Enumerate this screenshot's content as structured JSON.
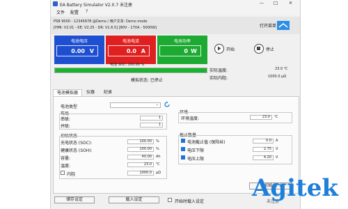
{
  "window": {
    "title": "EA Battery Simulator   V2.0.7   未注册",
    "minimize_glyph": "—",
    "maximize_glyph": "☐",
    "close_glyph": "✕"
  },
  "menu": [
    "文件",
    "配置",
    "?"
  ],
  "device": {
    "line1": "PSB 9000 - 12345678 @Demo / 用户文本: Demo mode",
    "line2": "[HMI: V2.01 - KE: V2.25 - DR: V1.6.5] [80V - 170A - 5000W]",
    "open_menu_label": "打开菜单"
  },
  "tiles": [
    {
      "label": "电池电压",
      "value": "0.00",
      "unit": "V",
      "color": "#1f4fd1"
    },
    {
      "label": "电池电流",
      "value": "0.0",
      "unit": "A",
      "color": "#e02020"
    },
    {
      "label": "电池功率",
      "value": "0",
      "unit": "W",
      "color": "#1daa32"
    }
  ],
  "controls": {
    "start_label": "开始",
    "stop_label": "停止"
  },
  "soc": {
    "text": "电池 SOC: 100.00 %",
    "percent": 100,
    "bar_color": "#18b42e"
  },
  "status": {
    "text": "模拟状态: 已停止"
  },
  "readouts": {
    "temp_label": "实际温度:",
    "temp_value": "23.0 ℃",
    "resistance_label": "实际内阻:",
    "resistance_value": "1000.0 μΩ"
  },
  "tabs": [
    "电池模拟器",
    "仪器",
    "纪录"
  ],
  "battery_type": {
    "label": "电池类型",
    "value": "",
    "refresh_icon": "refresh-icon"
  },
  "layout_group": {
    "title": "布局",
    "series_label": "串联:",
    "series_value": "1",
    "parallel_label": "并联:",
    "parallel_value": "1"
  },
  "environment": {
    "title": "环境",
    "temp_label": "环境温度:",
    "temp_value": "23.0",
    "temp_unit": "℃"
  },
  "initial_state": {
    "title": "初始状态",
    "rows": [
      {
        "label": "充电状态 (SOC):",
        "value": "100.00",
        "unit": "%"
      },
      {
        "label": "健康状态 (SOH):",
        "value": "100.00",
        "unit": "%"
      },
      {
        "label": "容量:",
        "value": "40.00",
        "unit": "Ah"
      },
      {
        "label": "温度:",
        "value": "23.0",
        "unit": "℃"
      }
    ],
    "internal_resistance": {
      "label": "内阻",
      "value": "1000.0",
      "unit": "μΩ",
      "checked": false
    }
  },
  "shutdown": {
    "title": "截止数量",
    "rows": [
      {
        "label": "电池截止值 (保险丝)",
        "value": "0.0",
        "unit": "A",
        "checked": true
      },
      {
        "label": "电压下限",
        "value": "2.75",
        "unit": "V",
        "checked": true
      },
      {
        "label": "电压上限",
        "value": "4.20",
        "unit": "V",
        "checked": true
      }
    ]
  },
  "init_button": "初始化",
  "bottom": {
    "save_label": "储存设定",
    "load_label": "载入设定",
    "autoload_label": "开始时载入设定",
    "autoload_checked": false,
    "corner_text": "未注册"
  },
  "watermark": {
    "text": "Agitek",
    "color": "#1e7fd8"
  }
}
